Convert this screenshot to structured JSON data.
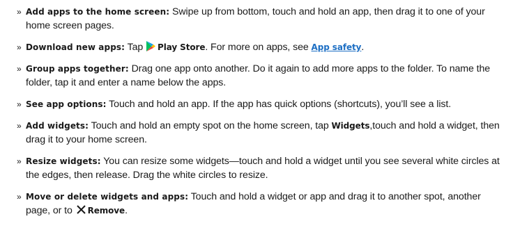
{
  "tips": [
    {
      "term": "Add apps to the home screen:",
      "text": " Swipe up from bottom, touch and hold an app, then drag it to one of your home screen pages."
    },
    {
      "term": "Download new apps:",
      "text_before": " Tap ",
      "icon": "play-store-icon",
      "inline_bold": "Play Store",
      "text_middle": ". For more on apps, see ",
      "link": "App safety",
      "text_after": "."
    },
    {
      "term": "Group apps together:",
      "text": " Drag one app onto another. Do it again to add more apps to the folder. To name the folder, tap it and enter a name below the apps."
    },
    {
      "term": "See app options:",
      "text": " Touch and hold an app. If the app has quick options (shortcuts), you’ll see a list."
    },
    {
      "term": "Add widgets:",
      "text_before": " Touch and hold an empty spot on the home screen, tap ",
      "inline_bold": "Widgets",
      "text_after": ",touch and hold a widget, then drag it to your home screen."
    },
    {
      "term": "Resize widgets:",
      "text": " You can resize some widgets—touch and hold a widget until you see several white circles at the edges, then release. Drag the white circles to resize."
    },
    {
      "term": "Move or delete widgets and apps:",
      "text_before": " Touch and hold a widget or app and drag it to another spot, another page, or to ",
      "icon": "close-x-icon",
      "inline_bold": "Remove",
      "text_after": "."
    }
  ],
  "bullet_char": "»",
  "colors": {
    "text": "#1a1a1a",
    "link": "#1d6fc4",
    "play_green": "#00c060",
    "play_blue": "#1a9ee8",
    "play_red": "#f0443a",
    "play_yellow": "#ffc107"
  }
}
